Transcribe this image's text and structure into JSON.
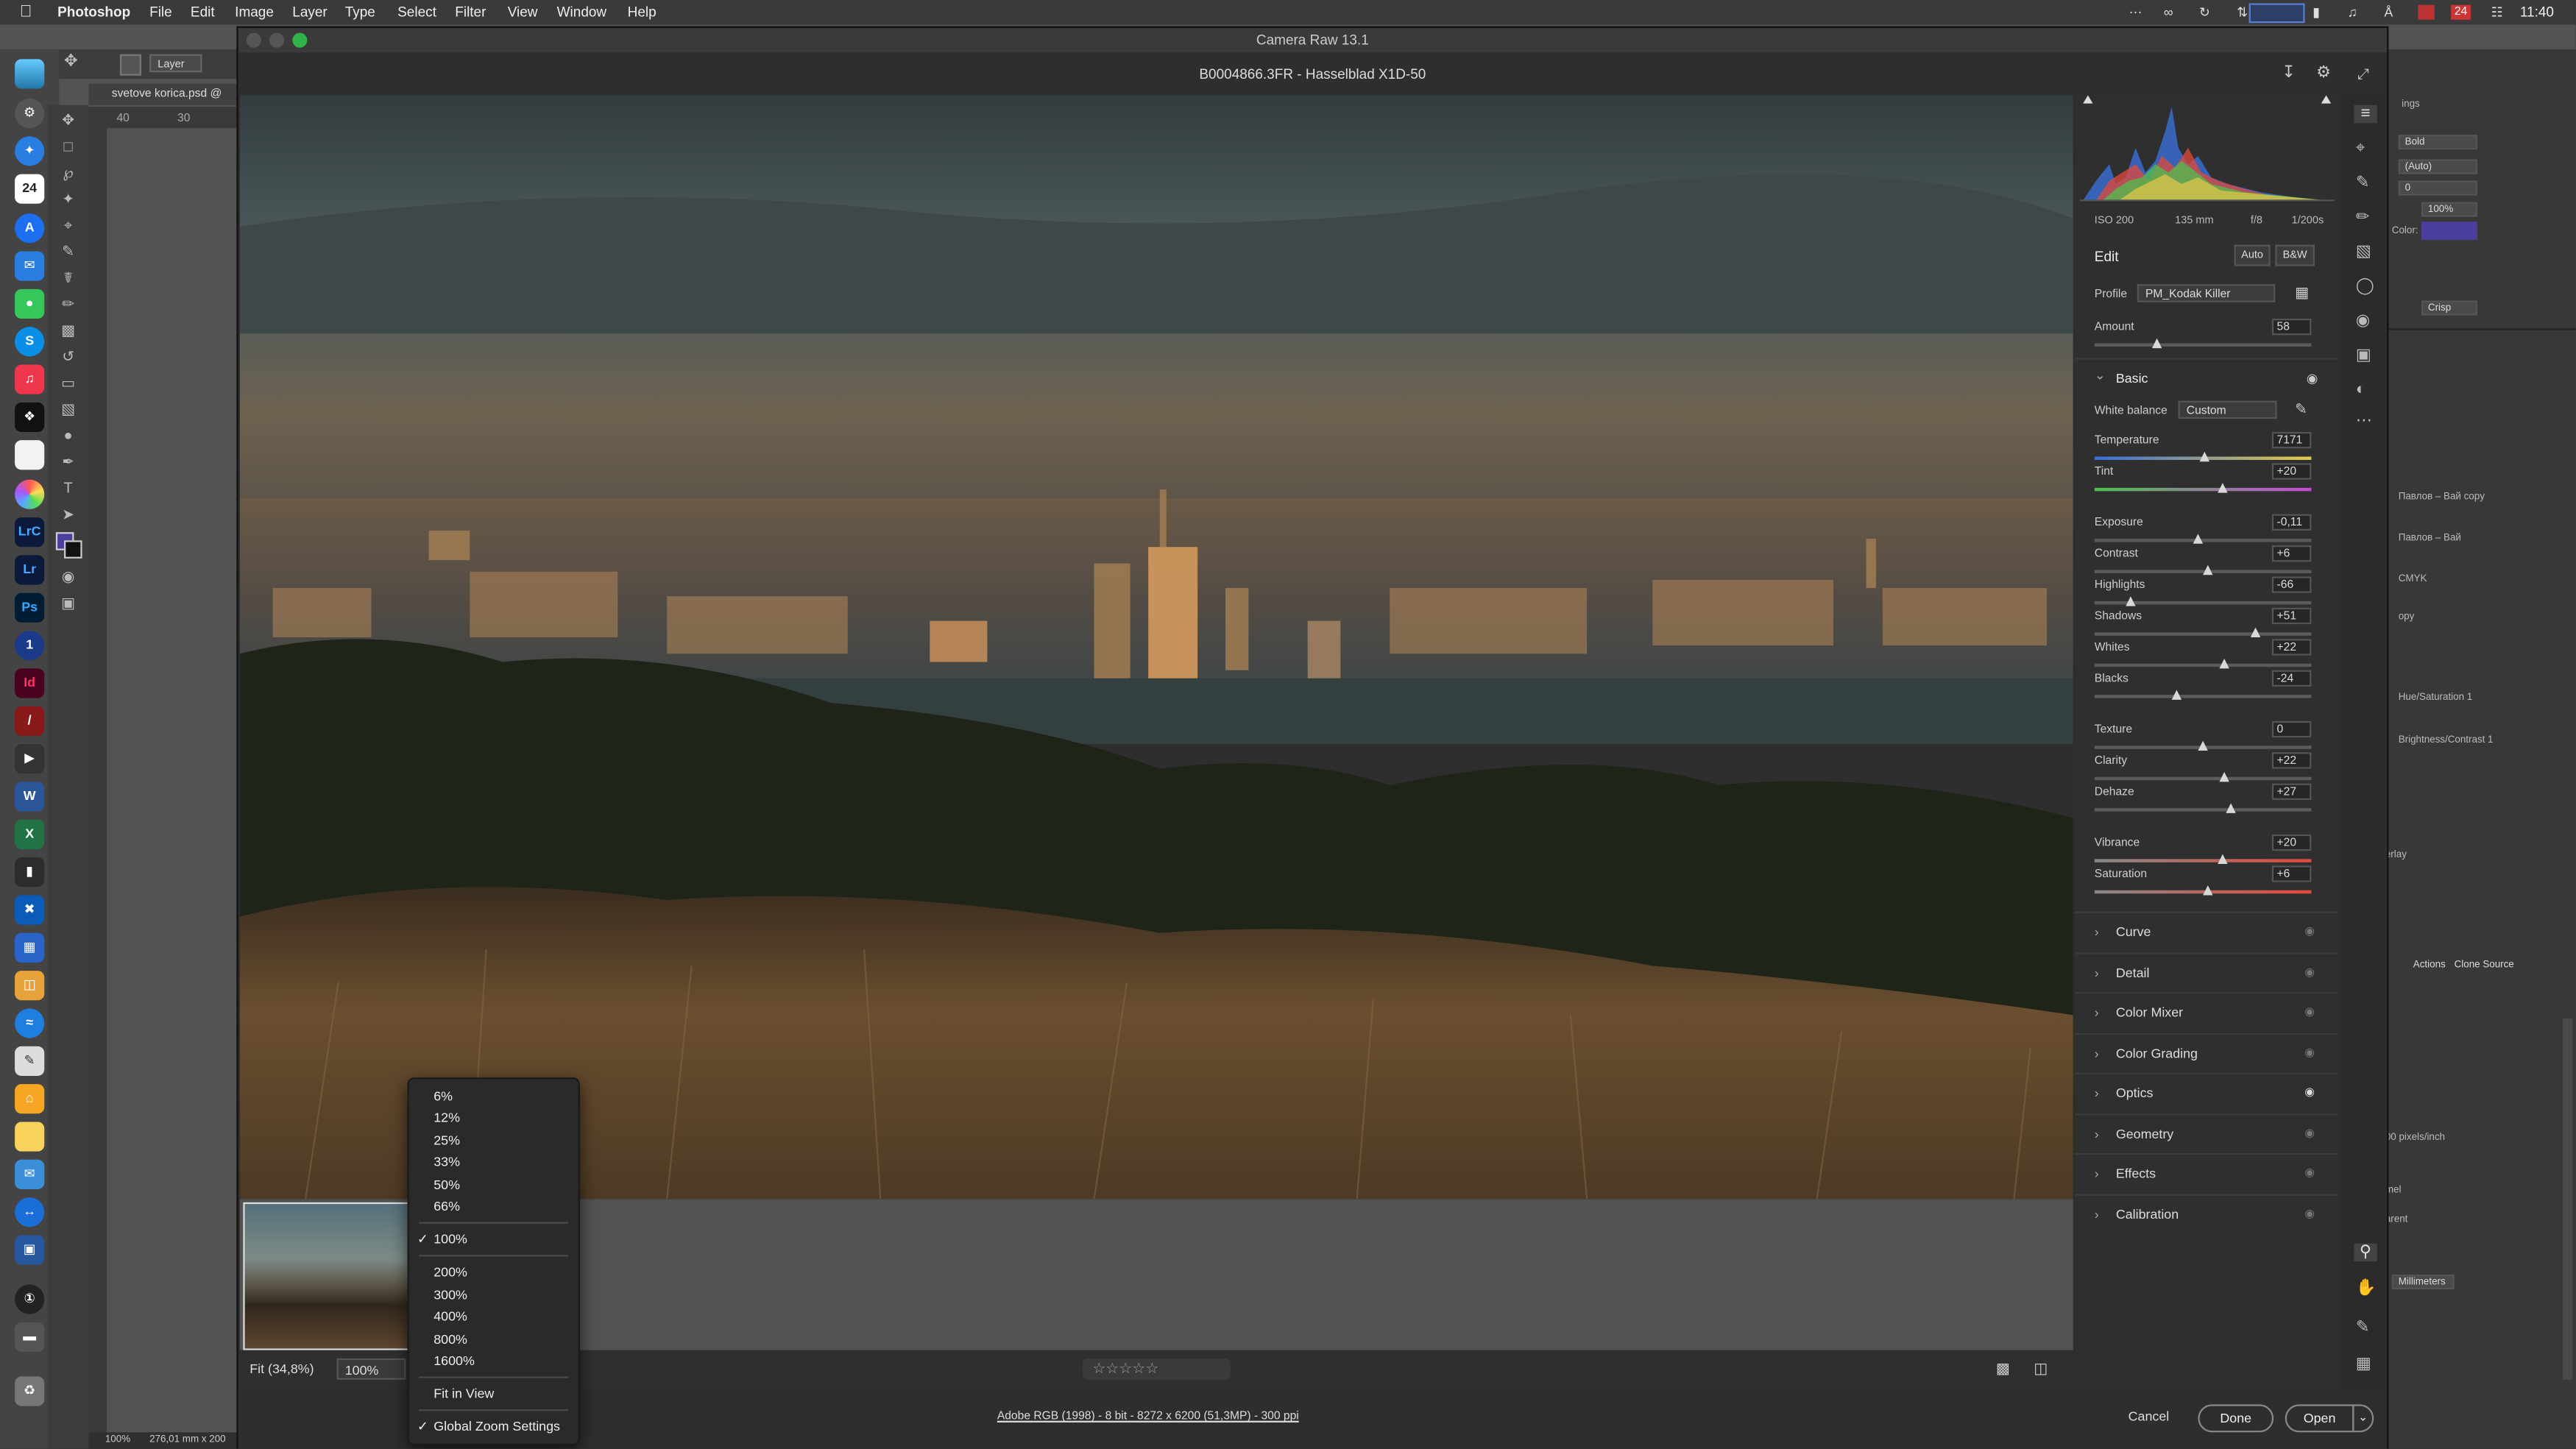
{
  "menubar": {
    "apple": "",
    "app_name": "Photoshop",
    "items": [
      "File",
      "Edit",
      "Image",
      "Layer",
      "Type",
      "Select",
      "Filter",
      "View",
      "Window",
      "Help"
    ],
    "date_badge": "24",
    "clock": "11:40"
  },
  "ps": {
    "options_layer": "Layer",
    "doc_tab": "svetove korica.psd @",
    "ruler_40": "40",
    "ruler_30": "30",
    "status_zoom": "100%",
    "status_size": "276,01 mm x 200"
  },
  "dock": {
    "calendar_day": "24",
    "lrc": "LrC",
    "lr": "Lr",
    "ps": "Ps",
    "id": "Id",
    "word": "W",
    "excel": "X",
    "skype": "S",
    "onepass": "1"
  },
  "camera_raw": {
    "window_title": "Camera Raw 13.1",
    "file_title": "B0004866.3FR  -  Hasselblad X1D-50",
    "meta": {
      "iso": "ISO 200",
      "focal": "135 mm",
      "aperture": "f/8",
      "shutter": "1/200s"
    },
    "edit_label": "Edit",
    "auto_label": "Auto",
    "bw_label": "B&W",
    "profile_label": "Profile",
    "profile_value": "PM_Kodak Killer",
    "amount": {
      "label": "Amount",
      "value": "58",
      "level": 0.29
    },
    "basic_label": "Basic",
    "wb_label": "White balance",
    "wb_value": "Custom",
    "sliders": [
      {
        "label": "Temperature",
        "value": "7171",
        "level": 0.51
      },
      {
        "label": "Tint",
        "value": "+20",
        "level": 0.59
      },
      {
        "label": "Exposure",
        "value": "-0,11",
        "level": 0.48
      },
      {
        "label": "Contrast",
        "value": "+6",
        "level": 0.52
      },
      {
        "label": "Highlights",
        "value": "-66",
        "level": 0.17
      },
      {
        "label": "Shadows",
        "value": "+51",
        "level": 0.74
      },
      {
        "label": "Whites",
        "value": "+22",
        "level": 0.6
      },
      {
        "label": "Blacks",
        "value": "-24",
        "level": 0.38
      },
      {
        "label": "Texture",
        "value": "0",
        "level": 0.5
      },
      {
        "label": "Clarity",
        "value": "+22",
        "level": 0.6
      },
      {
        "label": "Dehaze",
        "value": "+27",
        "level": 0.63
      },
      {
        "label": "Vibrance",
        "value": "+20",
        "level": 0.59
      },
      {
        "label": "Saturation",
        "value": "+6",
        "level": 0.52
      }
    ],
    "sections": [
      "Curve",
      "Detail",
      "Color Mixer",
      "Color Grading",
      "Optics",
      "Geometry",
      "Effects",
      "Calibration"
    ],
    "zoom_fit": "Fit (34,8%)",
    "zoom_current": "100%",
    "zoom_menu": {
      "items_top": [
        "6%",
        "12%",
        "25%",
        "33%",
        "50%",
        "66%"
      ],
      "checked": "100%",
      "items_bottom": [
        "200%",
        "300%",
        "400%",
        "800%",
        "1600%"
      ],
      "fit_in_view": "Fit in View",
      "global": "Global Zoom Settings"
    },
    "stars": "☆☆☆☆☆",
    "workflow_link": "Adobe RGB (1998) - 8 bit - 8272 x 6200 (51,3MP) - 300 ppi",
    "cancel": "Cancel",
    "done": "Done",
    "open": "Open"
  },
  "ps_panels": {
    "font_style": "Bold",
    "leading": "(Auto)",
    "tracking": "0",
    "scale": "100%",
    "color_label": "Color:",
    "aa": "Crisp",
    "layer1": "Павлов – Вай copy",
    "layer2": "Павлов – Вай",
    "layer3": "CMYK",
    "layer4": "opy",
    "layer5": "Hue/Saturation 1",
    "layer6": "Brightness/Contrast 1",
    "layer7": "erlay",
    "tab_actions": "Actions",
    "tab_clone": "Clone Source",
    "pixels_inch": "00 pixels/inch",
    "unit1": "mel",
    "unit2": "arent",
    "unit3": "Millimeters",
    "ings": "ings"
  },
  "colors": {
    "accent_swatch": "#4a3f9e",
    "dock_bg": "#444444"
  }
}
